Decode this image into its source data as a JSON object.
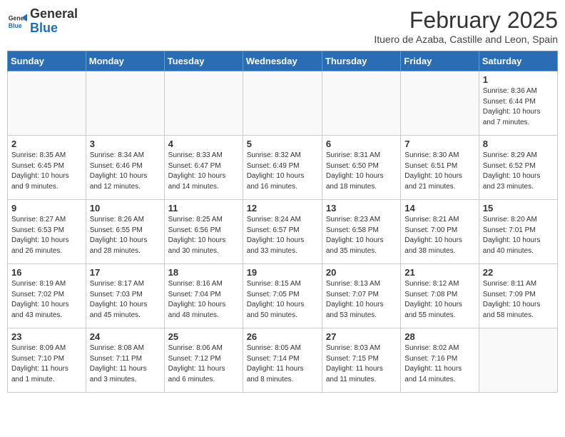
{
  "header": {
    "logo_general": "General",
    "logo_blue": "Blue",
    "month_year": "February 2025",
    "location": "Ituero de Azaba, Castille and Leon, Spain"
  },
  "days_of_week": [
    "Sunday",
    "Monday",
    "Tuesday",
    "Wednesday",
    "Thursday",
    "Friday",
    "Saturday"
  ],
  "weeks": [
    [
      {
        "day": "",
        "info": ""
      },
      {
        "day": "",
        "info": ""
      },
      {
        "day": "",
        "info": ""
      },
      {
        "day": "",
        "info": ""
      },
      {
        "day": "",
        "info": ""
      },
      {
        "day": "",
        "info": ""
      },
      {
        "day": "1",
        "info": "Sunrise: 8:36 AM\nSunset: 6:44 PM\nDaylight: 10 hours\nand 7 minutes."
      }
    ],
    [
      {
        "day": "2",
        "info": "Sunrise: 8:35 AM\nSunset: 6:45 PM\nDaylight: 10 hours\nand 9 minutes."
      },
      {
        "day": "3",
        "info": "Sunrise: 8:34 AM\nSunset: 6:46 PM\nDaylight: 10 hours\nand 12 minutes."
      },
      {
        "day": "4",
        "info": "Sunrise: 8:33 AM\nSunset: 6:47 PM\nDaylight: 10 hours\nand 14 minutes."
      },
      {
        "day": "5",
        "info": "Sunrise: 8:32 AM\nSunset: 6:49 PM\nDaylight: 10 hours\nand 16 minutes."
      },
      {
        "day": "6",
        "info": "Sunrise: 8:31 AM\nSunset: 6:50 PM\nDaylight: 10 hours\nand 18 minutes."
      },
      {
        "day": "7",
        "info": "Sunrise: 8:30 AM\nSunset: 6:51 PM\nDaylight: 10 hours\nand 21 minutes."
      },
      {
        "day": "8",
        "info": "Sunrise: 8:29 AM\nSunset: 6:52 PM\nDaylight: 10 hours\nand 23 minutes."
      }
    ],
    [
      {
        "day": "9",
        "info": "Sunrise: 8:27 AM\nSunset: 6:53 PM\nDaylight: 10 hours\nand 26 minutes."
      },
      {
        "day": "10",
        "info": "Sunrise: 8:26 AM\nSunset: 6:55 PM\nDaylight: 10 hours\nand 28 minutes."
      },
      {
        "day": "11",
        "info": "Sunrise: 8:25 AM\nSunset: 6:56 PM\nDaylight: 10 hours\nand 30 minutes."
      },
      {
        "day": "12",
        "info": "Sunrise: 8:24 AM\nSunset: 6:57 PM\nDaylight: 10 hours\nand 33 minutes."
      },
      {
        "day": "13",
        "info": "Sunrise: 8:23 AM\nSunset: 6:58 PM\nDaylight: 10 hours\nand 35 minutes."
      },
      {
        "day": "14",
        "info": "Sunrise: 8:21 AM\nSunset: 7:00 PM\nDaylight: 10 hours\nand 38 minutes."
      },
      {
        "day": "15",
        "info": "Sunrise: 8:20 AM\nSunset: 7:01 PM\nDaylight: 10 hours\nand 40 minutes."
      }
    ],
    [
      {
        "day": "16",
        "info": "Sunrise: 8:19 AM\nSunset: 7:02 PM\nDaylight: 10 hours\nand 43 minutes."
      },
      {
        "day": "17",
        "info": "Sunrise: 8:17 AM\nSunset: 7:03 PM\nDaylight: 10 hours\nand 45 minutes."
      },
      {
        "day": "18",
        "info": "Sunrise: 8:16 AM\nSunset: 7:04 PM\nDaylight: 10 hours\nand 48 minutes."
      },
      {
        "day": "19",
        "info": "Sunrise: 8:15 AM\nSunset: 7:05 PM\nDaylight: 10 hours\nand 50 minutes."
      },
      {
        "day": "20",
        "info": "Sunrise: 8:13 AM\nSunset: 7:07 PM\nDaylight: 10 hours\nand 53 minutes."
      },
      {
        "day": "21",
        "info": "Sunrise: 8:12 AM\nSunset: 7:08 PM\nDaylight: 10 hours\nand 55 minutes."
      },
      {
        "day": "22",
        "info": "Sunrise: 8:11 AM\nSunset: 7:09 PM\nDaylight: 10 hours\nand 58 minutes."
      }
    ],
    [
      {
        "day": "23",
        "info": "Sunrise: 8:09 AM\nSunset: 7:10 PM\nDaylight: 11 hours\nand 1 minute."
      },
      {
        "day": "24",
        "info": "Sunrise: 8:08 AM\nSunset: 7:11 PM\nDaylight: 11 hours\nand 3 minutes."
      },
      {
        "day": "25",
        "info": "Sunrise: 8:06 AM\nSunset: 7:12 PM\nDaylight: 11 hours\nand 6 minutes."
      },
      {
        "day": "26",
        "info": "Sunrise: 8:05 AM\nSunset: 7:14 PM\nDaylight: 11 hours\nand 8 minutes."
      },
      {
        "day": "27",
        "info": "Sunrise: 8:03 AM\nSunset: 7:15 PM\nDaylight: 11 hours\nand 11 minutes."
      },
      {
        "day": "28",
        "info": "Sunrise: 8:02 AM\nSunset: 7:16 PM\nDaylight: 11 hours\nand 14 minutes."
      },
      {
        "day": "",
        "info": ""
      }
    ]
  ]
}
